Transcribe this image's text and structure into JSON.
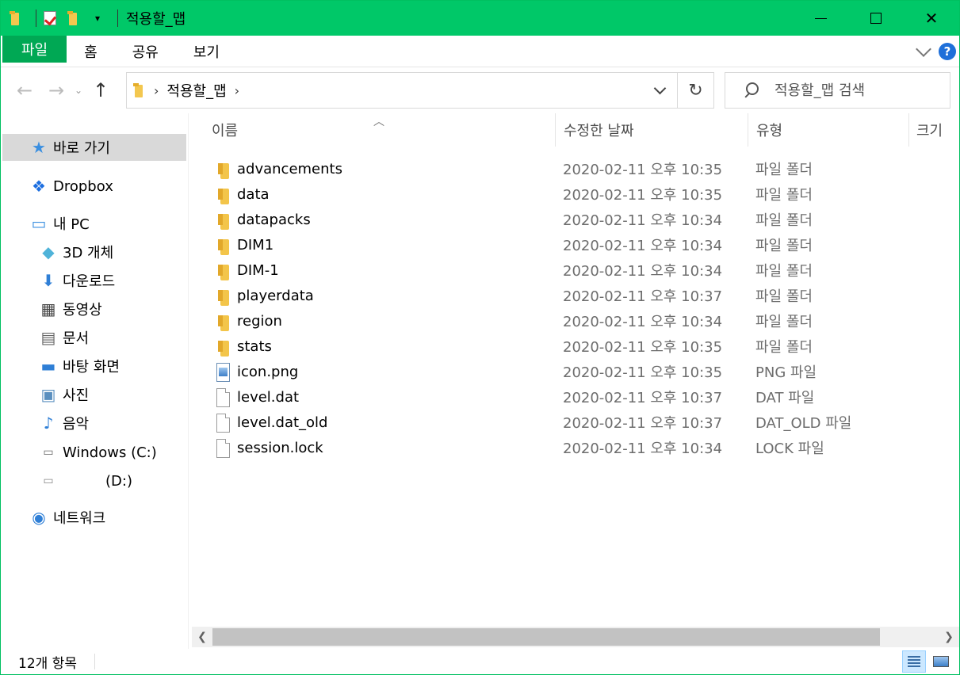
{
  "window": {
    "title": "적용할_맵"
  },
  "ribbon": {
    "tabs": [
      "파일",
      "홈",
      "공유",
      "보기"
    ]
  },
  "nav_bar": {
    "crumbs": [
      "적용할_맵"
    ],
    "search_placeholder": "적용할_맵 검색"
  },
  "sidebar": {
    "items": [
      {
        "label": "바로 가기",
        "icon": "star-icon"
      },
      {
        "label": "Dropbox",
        "icon": "dropbox-icon"
      },
      {
        "label": "내 PC",
        "icon": "computer-icon"
      },
      {
        "label": "3D 개체",
        "icon": "cube-icon"
      },
      {
        "label": "다운로드",
        "icon": "download-icon"
      },
      {
        "label": "동영상",
        "icon": "video-icon"
      },
      {
        "label": "문서",
        "icon": "document-icon"
      },
      {
        "label": "바탕 화면",
        "icon": "desktop-icon"
      },
      {
        "label": "사진",
        "icon": "pictures-icon"
      },
      {
        "label": "음악",
        "icon": "music-icon"
      },
      {
        "label": "Windows (C:)",
        "icon": "drive-icon"
      },
      {
        "label": "(D:)",
        "icon": "usb-drive-icon"
      },
      {
        "label": "네트워크",
        "icon": "network-icon"
      }
    ]
  },
  "columns": {
    "name": "이름",
    "modified": "수정한 날짜",
    "type": "유형",
    "size": "크기"
  },
  "files": [
    {
      "name": "advancements",
      "modified": "2020-02-11 오후 10:35",
      "type": "파일 폴더",
      "icon": "folder-icon"
    },
    {
      "name": "data",
      "modified": "2020-02-11 오후 10:35",
      "type": "파일 폴더",
      "icon": "folder-icon"
    },
    {
      "name": "datapacks",
      "modified": "2020-02-11 오후 10:34",
      "type": "파일 폴더",
      "icon": "folder-icon"
    },
    {
      "name": "DIM1",
      "modified": "2020-02-11 오후 10:34",
      "type": "파일 폴더",
      "icon": "folder-icon"
    },
    {
      "name": "DIM-1",
      "modified": "2020-02-11 오후 10:34",
      "type": "파일 폴더",
      "icon": "folder-icon"
    },
    {
      "name": "playerdata",
      "modified": "2020-02-11 오후 10:37",
      "type": "파일 폴더",
      "icon": "folder-icon"
    },
    {
      "name": "region",
      "modified": "2020-02-11 오후 10:34",
      "type": "파일 폴더",
      "icon": "folder-icon"
    },
    {
      "name": "stats",
      "modified": "2020-02-11 오후 10:35",
      "type": "파일 폴더",
      "icon": "folder-icon"
    },
    {
      "name": "icon.png",
      "modified": "2020-02-11 오후 10:35",
      "type": "PNG 파일",
      "icon": "image-file-icon"
    },
    {
      "name": "level.dat",
      "modified": "2020-02-11 오후 10:37",
      "type": "DAT 파일",
      "icon": "file-icon"
    },
    {
      "name": "level.dat_old",
      "modified": "2020-02-11 오후 10:37",
      "type": "DAT_OLD 파일",
      "icon": "file-icon"
    },
    {
      "name": "session.lock",
      "modified": "2020-02-11 오후 10:34",
      "type": "LOCK 파일",
      "icon": "file-icon"
    }
  ],
  "status": {
    "count": "12개 항목"
  },
  "colors": {
    "titlebar": "#00c868",
    "file_tab": "#00a854",
    "selection": "#d9d9d9"
  }
}
